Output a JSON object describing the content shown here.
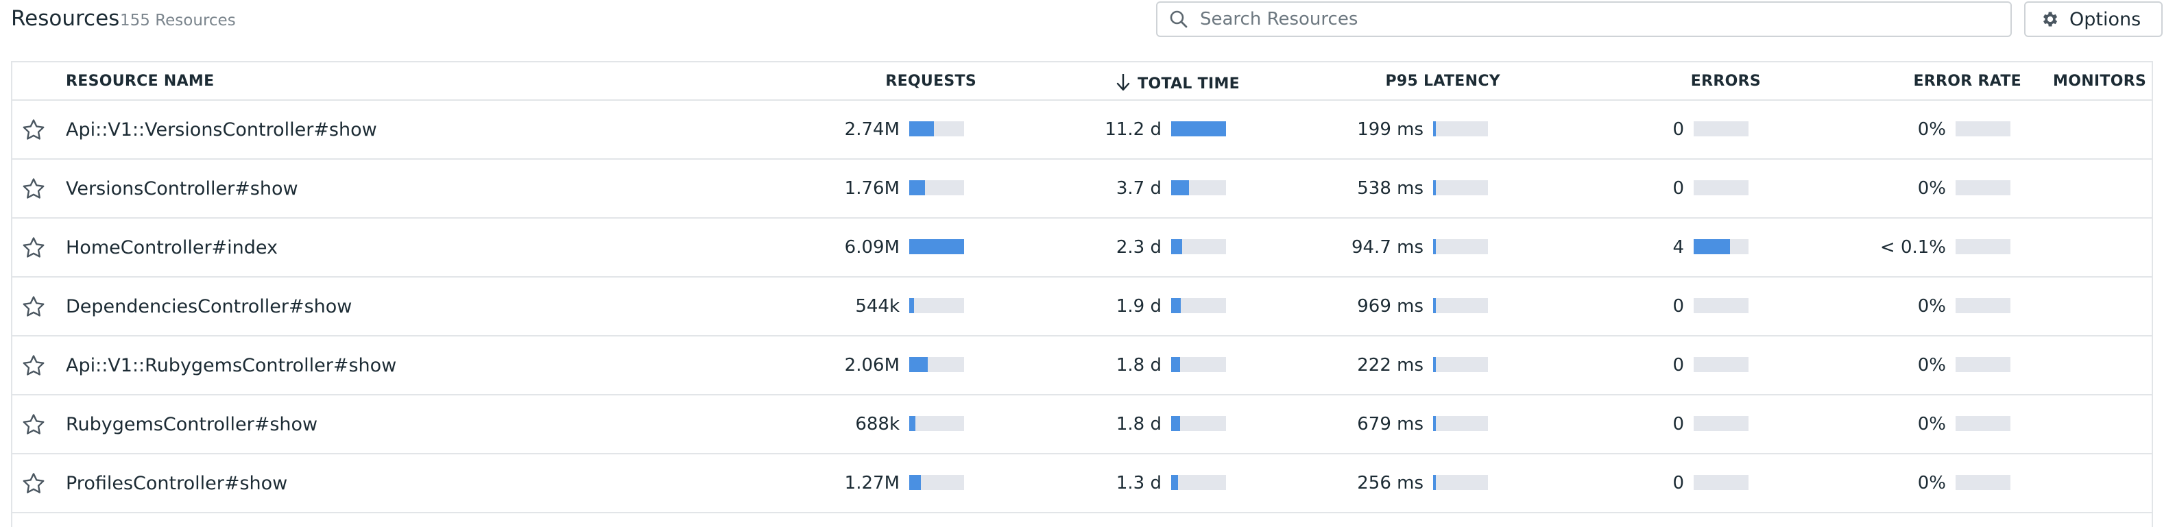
{
  "header": {
    "title": "Resources",
    "count": "155 Resources",
    "search_placeholder": "Search Resources",
    "options_label": "Options"
  },
  "table": {
    "columns": {
      "resource_name": "RESOURCE NAME",
      "requests": "REQUESTS",
      "total_time": "TOTAL TIME",
      "p95_latency": "P95 LATENCY",
      "errors": "ERRORS",
      "error_rate": "ERROR RATE",
      "monitors": "MONITORS"
    },
    "sorted_by": "total_time",
    "sort_direction": "descending",
    "rows": [
      {
        "name": "Api::V1::VersionsController#show",
        "requests": "2.74M",
        "requests_fill": 0.45,
        "total_time": "11.2 d",
        "total_time_fill": 1.0,
        "p95": "199 ms",
        "p95_fill": 0.02,
        "errors": "0",
        "errors_fill": 0,
        "error_rate": "0%",
        "error_rate_fill": 0
      },
      {
        "name": "VersionsController#show",
        "requests": "1.76M",
        "requests_fill": 0.29,
        "total_time": "3.7 d",
        "total_time_fill": 0.33,
        "p95": "538 ms",
        "p95_fill": 0.03,
        "errors": "0",
        "errors_fill": 0,
        "error_rate": "0%",
        "error_rate_fill": 0
      },
      {
        "name": "HomeController#index",
        "requests": "6.09M",
        "requests_fill": 1.0,
        "total_time": "2.3 d",
        "total_time_fill": 0.2,
        "p95": "94.7 ms",
        "p95_fill": 0.01,
        "errors": "4",
        "errors_fill": 0.66,
        "error_rate": "< 0.1%",
        "error_rate_fill": 0
      },
      {
        "name": "DependenciesController#show",
        "requests": "544k",
        "requests_fill": 0.09,
        "total_time": "1.9 d",
        "total_time_fill": 0.17,
        "p95": "969 ms",
        "p95_fill": 0.04,
        "errors": "0",
        "errors_fill": 0,
        "error_rate": "0%",
        "error_rate_fill": 0
      },
      {
        "name": "Api::V1::RubygemsController#show",
        "requests": "2.06M",
        "requests_fill": 0.34,
        "total_time": "1.8 d",
        "total_time_fill": 0.16,
        "p95": "222 ms",
        "p95_fill": 0.02,
        "errors": "0",
        "errors_fill": 0,
        "error_rate": "0%",
        "error_rate_fill": 0
      },
      {
        "name": "RubygemsController#show",
        "requests": "688k",
        "requests_fill": 0.11,
        "total_time": "1.8 d",
        "total_time_fill": 0.16,
        "p95": "679 ms",
        "p95_fill": 0.03,
        "errors": "0",
        "errors_fill": 0,
        "error_rate": "0%",
        "error_rate_fill": 0
      },
      {
        "name": "ProfilesController#show",
        "requests": "1.27M",
        "requests_fill": 0.21,
        "total_time": "1.3 d",
        "total_time_fill": 0.12,
        "p95": "256 ms",
        "p95_fill": 0.02,
        "errors": "0",
        "errors_fill": 0,
        "error_rate": "0%",
        "error_rate_fill": 0
      }
    ]
  },
  "colors": {
    "bar_fill": "#4a90e2",
    "bar_track": "#e3e6ec",
    "border": "#e2e5e8",
    "text": "#1c2b34",
    "muted_text": "#7b858d"
  },
  "icons": {
    "search": "search-icon",
    "options": "gear-icon",
    "sort": "arrow-down-icon",
    "favorite": "star-outline-icon"
  }
}
